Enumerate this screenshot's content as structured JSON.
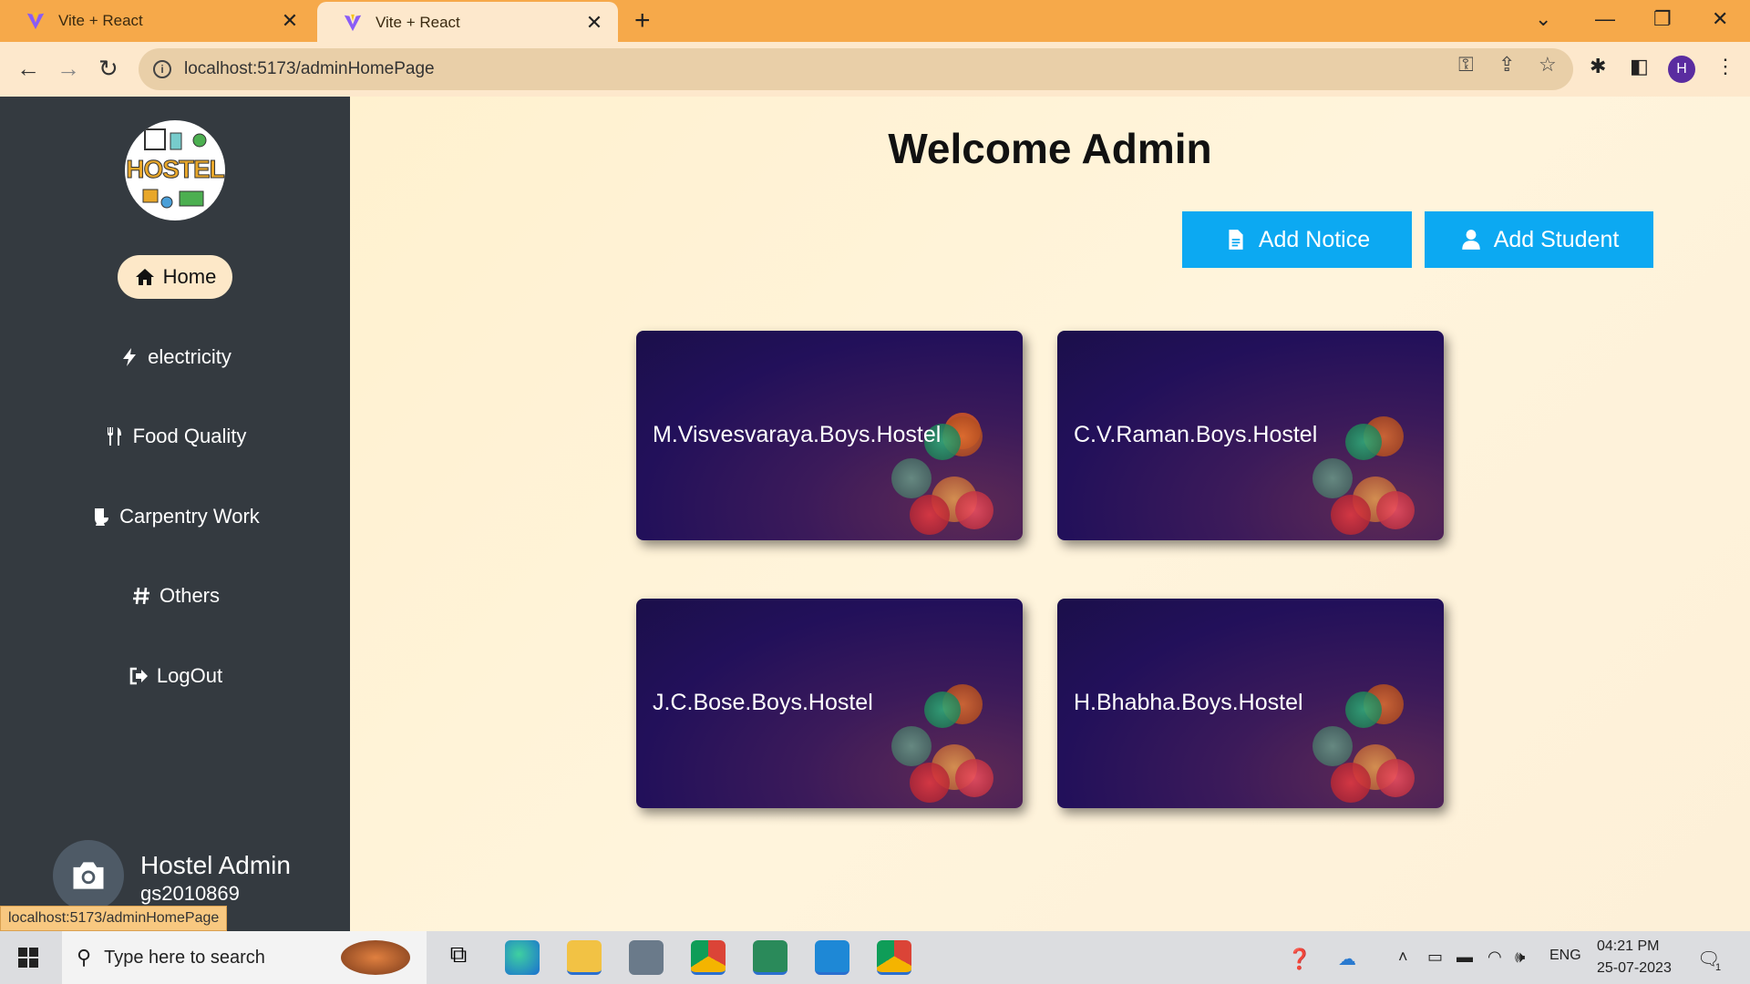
{
  "browser": {
    "tabs": [
      {
        "title": "Vite + React",
        "active": false
      },
      {
        "title": "Vite + React",
        "active": true
      }
    ],
    "url": "localhost:5173/adminHomePage",
    "profile_initial": "H",
    "accent": "#f6a94a"
  },
  "sidebar": {
    "logo_text": "HOSTEL",
    "items": [
      {
        "label": "Home",
        "icon": "home-icon",
        "active": true
      },
      {
        "label": "electricity",
        "icon": "bolt-icon"
      },
      {
        "label": "Food Quality",
        "icon": "utensils-icon"
      },
      {
        "label": "Carpentry Work",
        "icon": "toilet-icon"
      },
      {
        "label": "Others",
        "icon": "hash-icon"
      },
      {
        "label": "LogOut",
        "icon": "logout-icon"
      }
    ],
    "admin": {
      "name": "Hostel Admin",
      "id": "gs2010869",
      "avatar_icon": "camera-icon"
    },
    "status_url": "localhost:5173/adminHomePage"
  },
  "main": {
    "title": "Welcome Admin",
    "actions": {
      "add_notice": "Add Notice",
      "add_student": "Add Student"
    },
    "button_color": "#0ca9f2",
    "hostels": [
      {
        "name": "M.Visvesvaraya.Boys.Hostel"
      },
      {
        "name": "C.V.Raman.Boys.Hostel"
      },
      {
        "name": "J.C.Bose.Boys.Hostel"
      },
      {
        "name": "H.Bhabha.Boys.Hostel"
      }
    ]
  },
  "taskbar": {
    "search_placeholder": "Type here to search",
    "language": "ENG",
    "time": "04:21 PM",
    "date": "25-07-2023",
    "notification_count": "1"
  }
}
